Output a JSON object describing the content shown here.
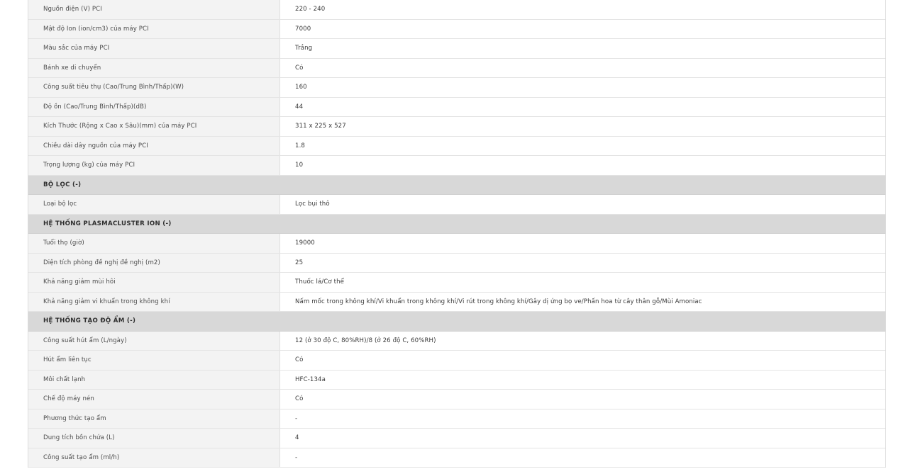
{
  "rows": [
    {
      "type": "spec",
      "label": "Nguồn điện (V) PCI",
      "value": "220 - 240"
    },
    {
      "type": "spec",
      "label": "Mật độ Ion (ion/cm3) của máy PCI",
      "value": "7000"
    },
    {
      "type": "spec",
      "label": "Màu sắc của máy PCI",
      "value": "Trắng"
    },
    {
      "type": "spec",
      "label": "Bánh xe di chuyển",
      "value": "Có"
    },
    {
      "type": "spec",
      "label": "Công suất tiêu thụ (Cao/Trung Bình/Thấp)(W)",
      "value": "160"
    },
    {
      "type": "spec",
      "label": "Độ ồn (Cao/Trung Bình/Thấp)(dB)",
      "value": "44"
    },
    {
      "type": "spec",
      "label": "Kích Thước (Rộng x Cao x Sâu)(mm) của máy PCI",
      "value": "311 x 225 x 527"
    },
    {
      "type": "spec",
      "label": "Chiều dài dây nguồn của máy PCI",
      "value": "1.8"
    },
    {
      "type": "spec",
      "label": "Trọng lượng (kg) của máy PCI",
      "value": "10"
    },
    {
      "type": "section",
      "label": "BỘ LỌC (-)"
    },
    {
      "type": "spec",
      "label": "Loại bộ lọc",
      "value": "Lọc bụi thô"
    },
    {
      "type": "section",
      "label": "HỆ THỐNG PLASMACLUSTER ION (-)"
    },
    {
      "type": "spec",
      "label": "Tuổi thọ (giờ)",
      "value": "19000"
    },
    {
      "type": "spec",
      "label": "Diện tích phòng đề nghị đề nghị (m2)",
      "value": "25"
    },
    {
      "type": "spec",
      "label": "Khả năng giảm mùi hôi",
      "value": "Thuốc lá/Cơ thể"
    },
    {
      "type": "spec",
      "label": "Khả năng giảm vi khuẩn trong không khí",
      "value": "Nấm mốc trong không khí/Vi khuẩn trong không khí/Vi rút trong không khí/Gây dị ứng bọ ve/Phấn hoa từ cây thân gỗ/Mùi Amoniac"
    },
    {
      "type": "section",
      "label": "HỆ THỐNG TẠO ĐỘ ẨM (-)"
    },
    {
      "type": "spec",
      "label": "Công suất hút ẩm (L/ngày)",
      "value": "12 (ở 30 độ C, 80%RH)/8 (ở 26 độ C, 60%RH)"
    },
    {
      "type": "spec",
      "label": "Hút ẩm liên tục",
      "value": "Có"
    },
    {
      "type": "spec",
      "label": "Môi chất lạnh",
      "value": "HFC-134a"
    },
    {
      "type": "spec",
      "label": "Chế độ máy nén",
      "value": "Có"
    },
    {
      "type": "spec",
      "label": "Phương thức tạo ẩm",
      "value": "-"
    },
    {
      "type": "spec",
      "label": "Dung tích bồn chứa (L)",
      "value": "4"
    },
    {
      "type": "spec",
      "label": "Công suất tạo ẩm (ml/h)",
      "value": "-"
    }
  ]
}
